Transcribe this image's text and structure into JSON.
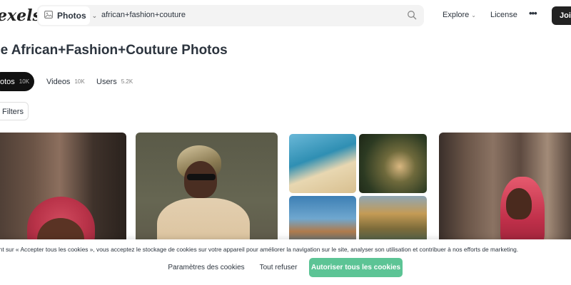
{
  "header": {
    "logo_text": "exels",
    "media_select": {
      "label": "Photos",
      "icon": "image-icon"
    },
    "search_value": "african+fashion+couture",
    "nav": {
      "explore": "Explore",
      "license": "License",
      "more": "•••",
      "join": "Join"
    }
  },
  "page": {
    "title": "ee African+Fashion+Couture Photos",
    "tabs": [
      {
        "label": "otos",
        "count": "10K"
      },
      {
        "label": "Videos",
        "count": "10K"
      },
      {
        "label": "Users",
        "count": "5.2K"
      }
    ],
    "filters_label": "Filters"
  },
  "cookie_banner": {
    "text": "ant sur « Accepter tous les cookies », vous acceptez le stockage de cookies sur votre appareil pour améliorer la navigation sur le site, analyser son utilisation et contribuer à nos efforts de marketing.",
    "settings_label": "Paramètres des cookies",
    "refuse_label": "Tout refuser",
    "accept_label": "Autoriser tous les cookies"
  },
  "colors": {
    "accent_green": "#5cc495",
    "dark": "#111111",
    "text": "#2c343e"
  }
}
